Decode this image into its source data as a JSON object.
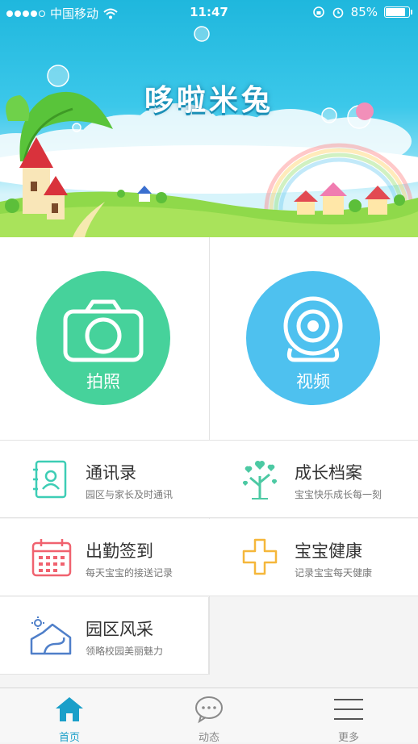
{
  "status_bar": {
    "carrier": "中国移动",
    "time": "11:47",
    "battery": "85%",
    "battery_level": 0.85
  },
  "banner": {
    "title": "哆啦米兔"
  },
  "main_actions": [
    {
      "label": "拍照",
      "color": "#46d29b",
      "icon": "camera-icon"
    },
    {
      "label": "视频",
      "color": "#4ec1ef",
      "icon": "webcam-icon"
    }
  ],
  "menu": [
    {
      "title": "通讯录",
      "subtitle": "园区与家长及时通讯",
      "icon": "contacts-book-icon",
      "color": "#3dcdb5"
    },
    {
      "title": "成长档案",
      "subtitle": "宝宝快乐成长每一刻",
      "icon": "growth-tree-icon",
      "color": "#4cc9a3"
    },
    {
      "title": "出勤签到",
      "subtitle": "每天宝宝的接送记录",
      "icon": "calendar-icon",
      "color": "#f0626f"
    },
    {
      "title": "宝宝健康",
      "subtitle": "记录宝宝每天健康",
      "icon": "health-cross-icon",
      "color": "#f5b73b"
    },
    {
      "title": "园区风采",
      "subtitle": "领略校园美丽魅力",
      "icon": "campus-house-icon",
      "color": "#4f7fc9"
    }
  ],
  "tab_bar": [
    {
      "label": "首页",
      "icon": "home-icon",
      "active": true
    },
    {
      "label": "动态",
      "icon": "chat-bubble-icon",
      "active": false
    },
    {
      "label": "更多",
      "icon": "menu-lines-icon",
      "active": false
    }
  ],
  "colors": {
    "accent": "#1a9fc9",
    "banner_sky": "#1fb7dd"
  }
}
